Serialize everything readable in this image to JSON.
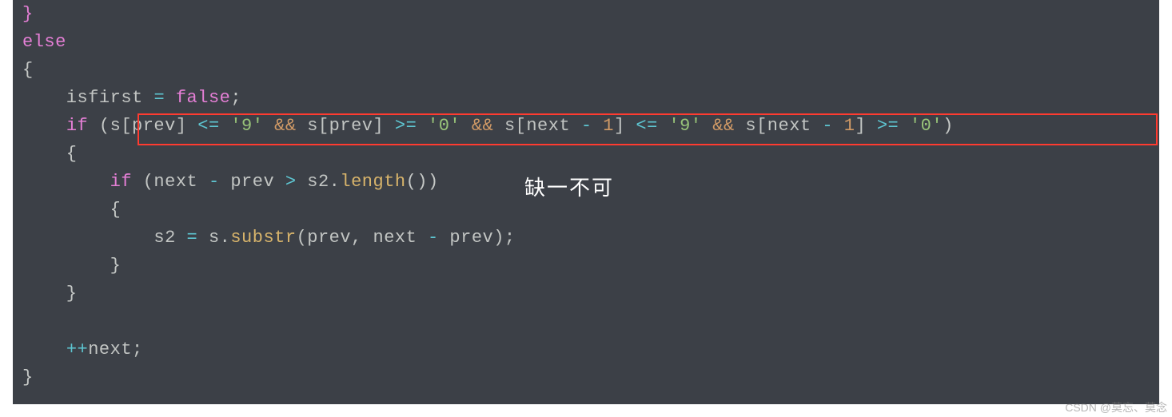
{
  "code": {
    "tokens": [
      [
        {
          "t": "}",
          "c": "kw"
        }
      ],
      [
        {
          "t": "else",
          "c": "kw"
        }
      ],
      [
        {
          "t": "{",
          "c": "brace"
        }
      ],
      [
        {
          "t": "    isfirst ",
          "c": "var"
        },
        {
          "t": "= ",
          "c": "op"
        },
        {
          "t": "false",
          "c": "kw"
        },
        {
          "t": ";",
          "c": "punct"
        }
      ],
      [
        {
          "t": "    ",
          "c": "var"
        },
        {
          "t": "if ",
          "c": "kw"
        },
        {
          "t": "(",
          "c": "punct"
        },
        {
          "t": "s[prev] ",
          "c": "var"
        },
        {
          "t": "<= ",
          "c": "op"
        },
        {
          "t": "'9' ",
          "c": "str"
        },
        {
          "t": "&& ",
          "c": "amp"
        },
        {
          "t": "s[prev] ",
          "c": "var"
        },
        {
          "t": ">= ",
          "c": "op"
        },
        {
          "t": "'0' ",
          "c": "str"
        },
        {
          "t": "&& ",
          "c": "amp"
        },
        {
          "t": "s[next ",
          "c": "var"
        },
        {
          "t": "- ",
          "c": "op"
        },
        {
          "t": "1",
          "c": "num"
        },
        {
          "t": "] ",
          "c": "var"
        },
        {
          "t": "<= ",
          "c": "op"
        },
        {
          "t": "'9' ",
          "c": "str"
        },
        {
          "t": "&& ",
          "c": "amp"
        },
        {
          "t": "s[next ",
          "c": "var"
        },
        {
          "t": "- ",
          "c": "op"
        },
        {
          "t": "1",
          "c": "num"
        },
        {
          "t": "] ",
          "c": "var"
        },
        {
          "t": ">= ",
          "c": "op"
        },
        {
          "t": "'0'",
          "c": "str"
        },
        {
          "t": ")",
          "c": "punct"
        }
      ],
      [
        {
          "t": "    {",
          "c": "brace"
        }
      ],
      [
        {
          "t": "        ",
          "c": "var"
        },
        {
          "t": "if ",
          "c": "kw"
        },
        {
          "t": "(next ",
          "c": "var"
        },
        {
          "t": "- ",
          "c": "op"
        },
        {
          "t": "prev ",
          "c": "var"
        },
        {
          "t": "> ",
          "c": "op"
        },
        {
          "t": "s2.",
          "c": "var"
        },
        {
          "t": "length",
          "c": "fn"
        },
        {
          "t": "())",
          "c": "punct"
        }
      ],
      [
        {
          "t": "        {",
          "c": "brace"
        }
      ],
      [
        {
          "t": "            s2 ",
          "c": "var"
        },
        {
          "t": "= ",
          "c": "op"
        },
        {
          "t": "s.",
          "c": "var"
        },
        {
          "t": "substr",
          "c": "fn"
        },
        {
          "t": "(prev, next ",
          "c": "var"
        },
        {
          "t": "- ",
          "c": "op"
        },
        {
          "t": "prev);",
          "c": "var"
        }
      ],
      [
        {
          "t": "        }",
          "c": "brace"
        }
      ],
      [
        {
          "t": "    }",
          "c": "brace"
        }
      ],
      [
        {
          "t": "",
          "c": "var"
        }
      ],
      [
        {
          "t": "    ",
          "c": "var"
        },
        {
          "t": "++",
          "c": "op"
        },
        {
          "t": "next;",
          "c": "var"
        }
      ],
      [
        {
          "t": "}",
          "c": "brace"
        }
      ]
    ]
  },
  "annotation": "缺一不可",
  "watermark": "CSDN @莫忘、莫念",
  "colors": {
    "background": "#3c4047",
    "highlight_box": "#ff3b30",
    "keyword": "#e57fd6",
    "operator": "#5ec6d2",
    "string": "#98c379",
    "function": "#d8b46b",
    "amp": "#d19a66",
    "text": "#c5c8c6"
  }
}
